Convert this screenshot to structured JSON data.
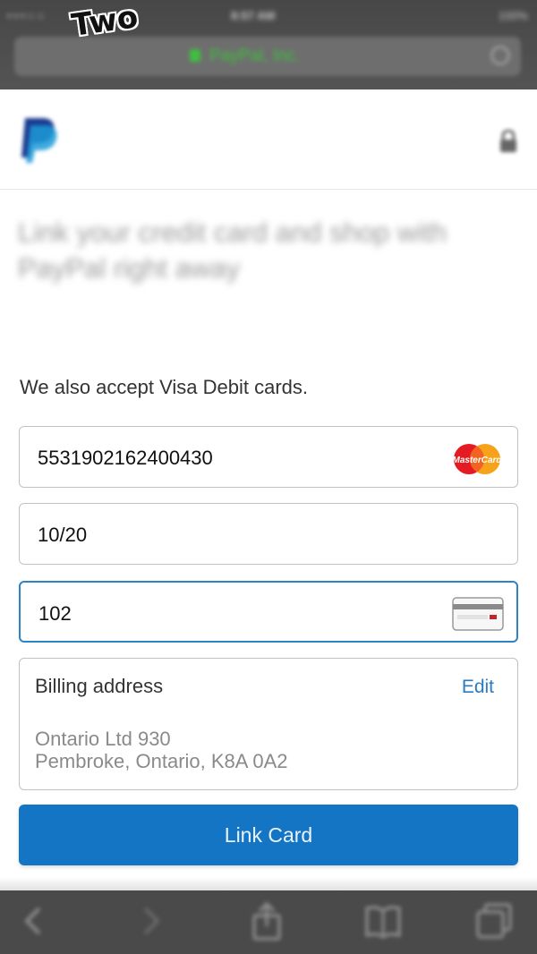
{
  "watermark": "Two",
  "status_bar": {
    "carrier": "•••○○",
    "time": "8:57 AM",
    "indicators": "100%"
  },
  "url_bar": {
    "site": "PayPal, Inc."
  },
  "header": {
    "logo_icon": "paypal-logo",
    "lock_icon": "lock-icon"
  },
  "headline": "Link your credit card and shop with PayPal right away",
  "accept_note": "We also accept Visa Debit cards.",
  "card_form": {
    "card_number": "5531902162400430",
    "card_brand": "MasterCard",
    "expiry": "10/20",
    "cvv": "102"
  },
  "billing": {
    "title": "Billing address",
    "edit_label": "Edit",
    "line1": "Ontario Ltd 930",
    "line2": "Pembroke, Ontario, K8A 0A2"
  },
  "link_button": "Link Card",
  "colors": {
    "primary": "#1475c4",
    "link": "#2b7bc1",
    "active_border": "#2f83c3"
  },
  "toolbar": {
    "icons": [
      "back-icon",
      "forward-icon",
      "share-icon",
      "bookmarks-icon",
      "tabs-icon"
    ]
  }
}
